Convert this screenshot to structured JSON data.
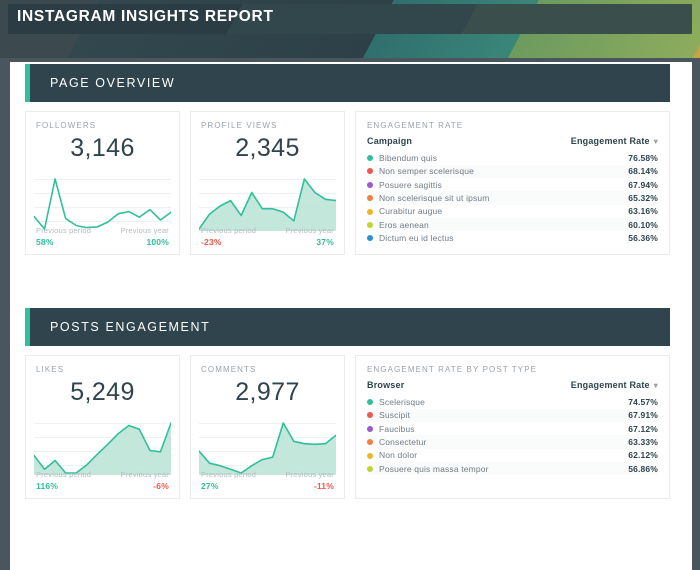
{
  "header": {
    "title": "INSTAGRAM INSIGHTS REPORT"
  },
  "colors": {
    "accent_teal": "#2fbf9a",
    "header_dark": "#2f444c",
    "positive": "#2fbf9a",
    "negative": "#f0564a"
  },
  "sections": [
    {
      "title": "PAGE OVERVIEW",
      "kpis": [
        {
          "label": "FOLLOWERS",
          "value": "3,146",
          "prev_period_caption": "Previous period",
          "prev_period_pct": "58%",
          "prev_period_dir": "up",
          "prev_year_caption": "Previous year",
          "prev_year_pct": "100%",
          "prev_year_dir": "up",
          "chart": {
            "type": "line",
            "filled": false,
            "values": [
              38,
              20,
              92,
              35,
              25,
              22,
              23,
              30,
              42,
              45,
              37,
              48,
              33,
              44
            ]
          }
        },
        {
          "label": "PROFILE VIEWS",
          "value": "2,345",
          "prev_period_caption": "Previous period",
          "prev_period_pct": "-23%",
          "prev_period_dir": "down",
          "prev_year_caption": "Previous year",
          "prev_year_pct": "37%",
          "prev_year_dir": "up",
          "chart": {
            "type": "area",
            "filled": true,
            "values": [
              8,
              30,
              42,
              50,
              28,
              62,
              38,
              38,
              33,
              20,
              82,
              62,
              52,
              50
            ]
          }
        }
      ],
      "table": {
        "label": "ENGAGEMENT RATE",
        "columns": [
          "Campaign",
          "Engagement Rate"
        ],
        "sort_icon": "chevron-down-icon",
        "rows": [
          {
            "color": "#2fbf9a",
            "name": "Bibendum quis",
            "value": "76.58%"
          },
          {
            "color": "#f0564a",
            "name": "Non semper scelerisque",
            "value": "68.14%"
          },
          {
            "color": "#9b59d0",
            "name": "Posuere sagittis",
            "value": "67.94%"
          },
          {
            "color": "#f2803c",
            "name": "Non scelerisque sit ut ipsum",
            "value": "65.32%"
          },
          {
            "color": "#f0b429",
            "name": "Curabitur augue",
            "value": "63.16%"
          },
          {
            "color": "#c2d430",
            "name": "Eros aenean",
            "value": "60.10%"
          },
          {
            "color": "#2a8fd4",
            "name": "Dictum eu id lectus",
            "value": "56.36%"
          }
        ]
      }
    },
    {
      "title": "POSTS ENGAGEMENT",
      "kpis": [
        {
          "label": "LIKES",
          "value": "5,249",
          "prev_period_caption": "Previous period",
          "prev_period_pct": "116%",
          "prev_period_dir": "up",
          "prev_year_caption": "Previous year",
          "prev_year_pct": "-6%",
          "prev_year_dir": "down",
          "chart": {
            "type": "area",
            "filled": true,
            "values": [
              40,
              18,
              32,
              12,
              12,
              25,
              42,
              58,
              75,
              88,
              82,
              48,
              46,
              92
            ]
          }
        },
        {
          "label": "COMMENTS",
          "value": "2,977",
          "prev_period_caption": "Previous period",
          "prev_period_pct": "27%",
          "prev_period_dir": "up",
          "prev_year_caption": "Previous year",
          "prev_year_pct": "-11%",
          "prev_year_dir": "down",
          "chart": {
            "type": "area",
            "filled": true,
            "values": [
              46,
              26,
              22,
              16,
              10,
              22,
              32,
              36,
              92,
              62,
              58,
              57,
              58,
              72
            ]
          }
        }
      ],
      "table": {
        "label": "ENGAGEMENT RATE BY POST TYPE",
        "columns": [
          "Browser",
          "Engagement Rate"
        ],
        "sort_icon": "chevron-down-icon",
        "rows": [
          {
            "color": "#2fbf9a",
            "name": "Scelerisque",
            "value": "74.57%"
          },
          {
            "color": "#f0564a",
            "name": "Suscipit",
            "value": "67.91%"
          },
          {
            "color": "#9b59d0",
            "name": "Faucibus",
            "value": "67.12%"
          },
          {
            "color": "#f2803c",
            "name": "Consectetur",
            "value": "63.33%"
          },
          {
            "color": "#f0b429",
            "name": "Non dolor",
            "value": "62.12%"
          },
          {
            "color": "#c2d430",
            "name": "Posuere quis massa tempor",
            "value": "56.86%"
          }
        ]
      }
    }
  ]
}
